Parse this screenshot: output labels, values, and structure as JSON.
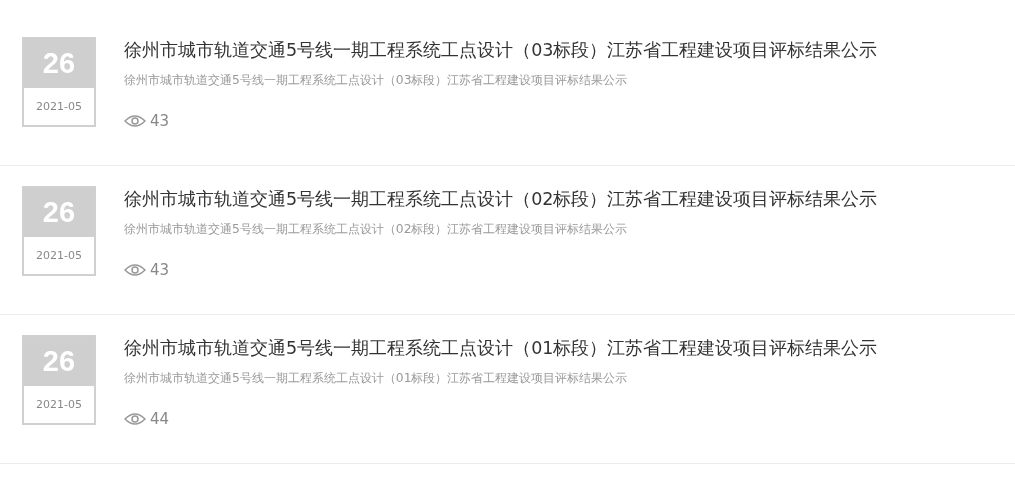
{
  "articles": [
    {
      "day": "26",
      "month": "2021-05",
      "title": "徐州市城市轨道交通5号线一期工程系统工点设计（03标段）江苏省工程建设项目评标结果公示",
      "summary": "徐州市城市轨道交通5号线一期工程系统工点设计（03标段）江苏省工程建设项目评标结果公示",
      "views": "43"
    },
    {
      "day": "26",
      "month": "2021-05",
      "title": "徐州市城市轨道交通5号线一期工程系统工点设计（02标段）江苏省工程建设项目评标结果公示",
      "summary": "徐州市城市轨道交通5号线一期工程系统工点设计（02标段）江苏省工程建设项目评标结果公示",
      "views": "43"
    },
    {
      "day": "26",
      "month": "2021-05",
      "title": "徐州市城市轨道交通5号线一期工程系统工点设计（01标段）江苏省工程建设项目评标结果公示",
      "summary": "徐州市城市轨道交通5号线一期工程系统工点设计（01标段）江苏省工程建设项目评标结果公示",
      "views": "44"
    }
  ]
}
